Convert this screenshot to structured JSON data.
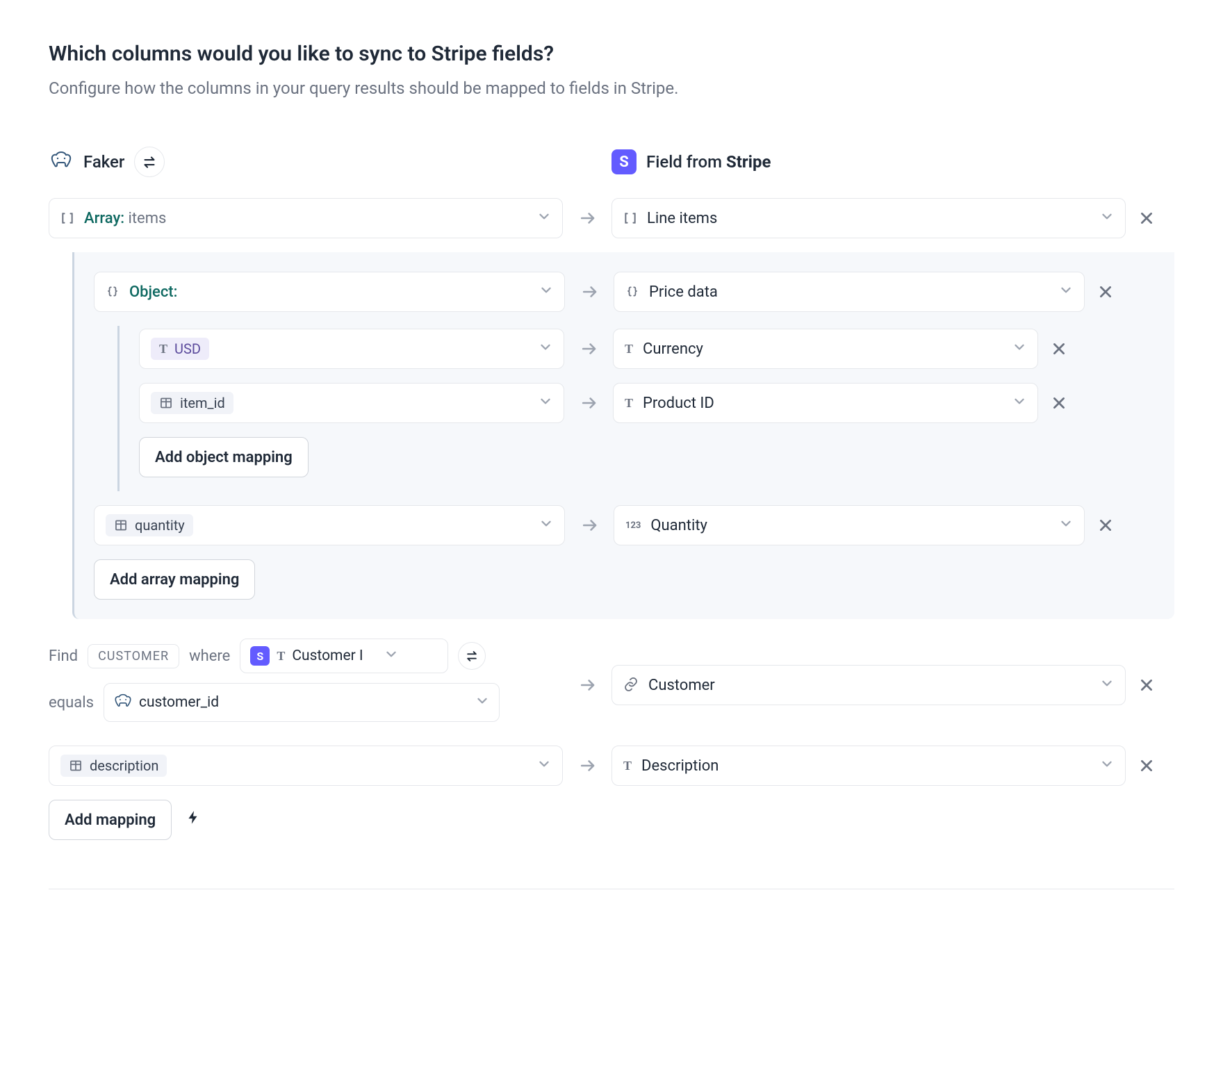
{
  "header": {
    "title": "Which columns would you like to sync to Stripe fields?",
    "subtitle": "Configure how the columns in your query results should be mapped to fields in Stripe."
  },
  "columns": {
    "source_name": "Faker",
    "dest_prefix": "Field from ",
    "dest_name": "Stripe"
  },
  "mappings": {
    "array": {
      "source_label_prefix": "Array: ",
      "source_label_value": "items",
      "dest_label": "Line items",
      "object": {
        "source_label": "Object:",
        "dest_label": "Price data",
        "fields": [
          {
            "source": "USD",
            "dest": "Currency"
          },
          {
            "source": "item_id",
            "dest": "Product ID"
          }
        ],
        "add_object_btn": "Add object mapping"
      },
      "quantity": {
        "source": "quantity",
        "dest": "Quantity"
      },
      "add_array_btn": "Add array mapping"
    },
    "customer": {
      "find_label": "Find",
      "tag": "CUSTOMER",
      "where_label": "where",
      "where_field": "Customer I",
      "equals_label": "equals",
      "equals_field": "customer_id",
      "dest_label": "Customer"
    },
    "description": {
      "source": "description",
      "dest": "Description"
    }
  },
  "footer": {
    "add_mapping_btn": "Add mapping"
  }
}
